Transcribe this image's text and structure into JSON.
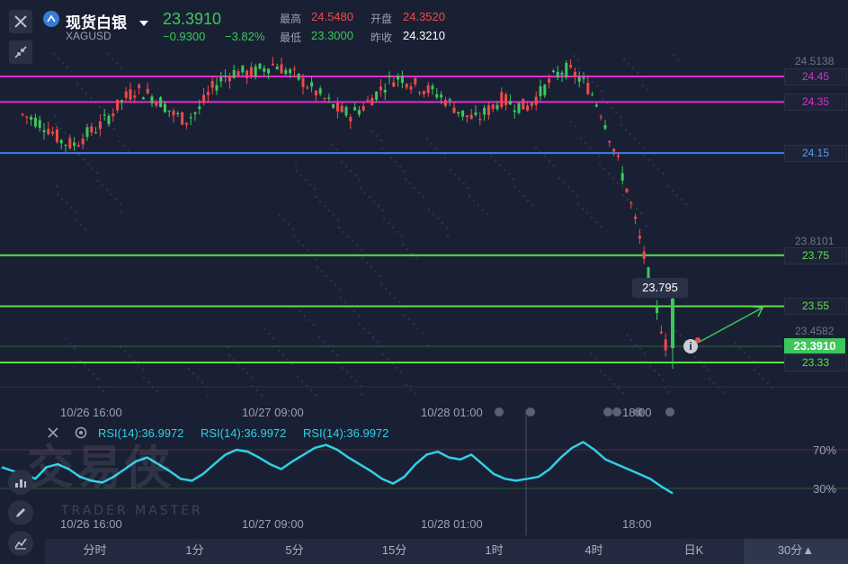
{
  "header": {
    "name": "现货白银",
    "symbol": "XAGUSD",
    "price": "23.3910",
    "change": "−0.9300",
    "change_pct": "−3.82%",
    "high_label": "最高",
    "high_value": "24.5480",
    "open_label": "开盘",
    "open_value": "24.3520",
    "low_label": "最低",
    "low_value": "23.3000",
    "prev_label": "昨收",
    "prev_value": "24.3210"
  },
  "axis": {
    "top_value": "24.5138",
    "mid_value": "23.8101",
    "low_value": "23.4582",
    "current_price": "23.3910"
  },
  "levels": [
    {
      "value": 24.45,
      "label": "24.45",
      "color": "#e62ad0"
    },
    {
      "value": 24.35,
      "label": "24.35",
      "color": "#e62ad0"
    },
    {
      "value": 24.15,
      "label": "24.15",
      "color": "#3e7ff0"
    },
    {
      "value": 23.75,
      "label": "23.75",
      "color": "#5ee04a"
    },
    {
      "value": 23.55,
      "label": "23.55",
      "color": "#5ee04a"
    },
    {
      "value": 23.33,
      "label": "23.33",
      "color": "#5ee04a"
    }
  ],
  "tooltip": "23.795",
  "time_labels": [
    "10/26 16:00",
    "10/27 09:00",
    "10/28 01:00",
    "18:00"
  ],
  "rsi": {
    "labels": [
      "RSI(14):36.9972",
      "RSI(14):36.9972",
      "RSI(14):36.9972"
    ],
    "level_high": "70%",
    "level_low": "30%"
  },
  "watermark": {
    "brand": "交易侠",
    "sub": "TRADER MASTER"
  },
  "timeframes": [
    "分时",
    "1分",
    "5分",
    "15分",
    "1时",
    "4时",
    "日K",
    "30分▲"
  ],
  "colors": {
    "up": "#f04a4a",
    "down": "#3cc85a",
    "rsi": "#2fd0e6",
    "accent_green": "#3cc85a"
  }
}
